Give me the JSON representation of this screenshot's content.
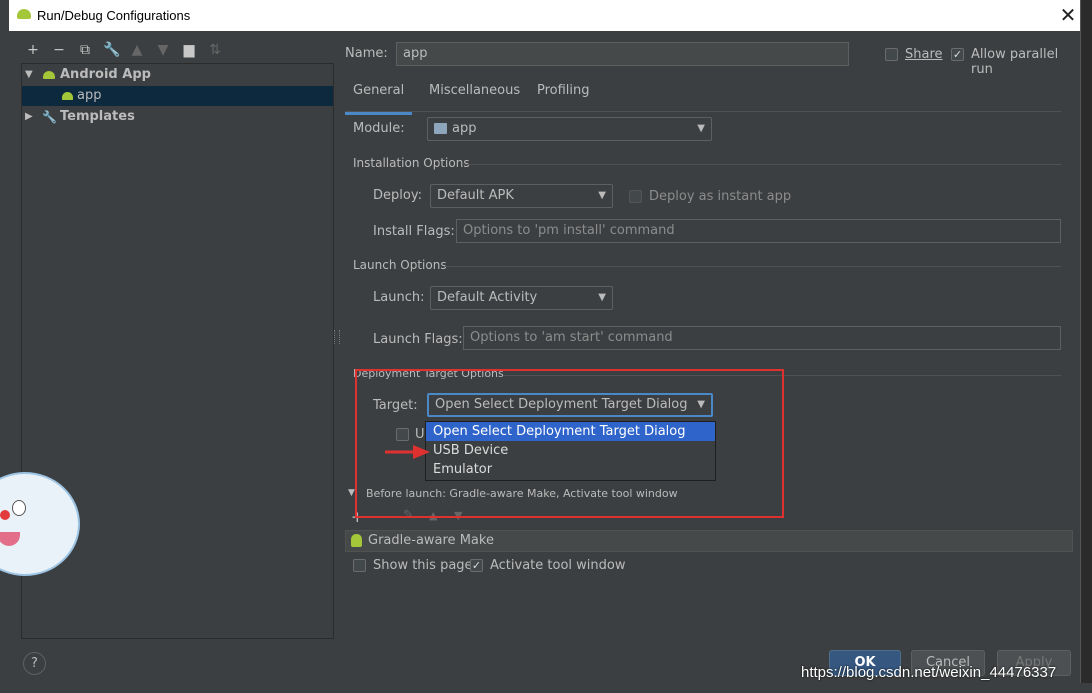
{
  "window": {
    "title": "Run/Debug Configurations",
    "close_glyph": "✕"
  },
  "toolbar": {
    "icons": [
      "add-icon",
      "remove-icon",
      "copy-icon",
      "wrench-icon",
      "move-up-icon",
      "move-down-icon",
      "folder-icon",
      "sort-icon"
    ]
  },
  "tree": {
    "android_app": "Android App",
    "app": "app",
    "templates": "Templates"
  },
  "header": {
    "name_label": "Name:",
    "name_value": "app",
    "share_label": "Share",
    "share_checked": false,
    "parallel_label": "Allow parallel run",
    "parallel_checked": true
  },
  "tabs": [
    {
      "label": "General",
      "active": true
    },
    {
      "label": "Miscellaneous",
      "active": false
    },
    {
      "label": "Profiling",
      "active": false
    }
  ],
  "module": {
    "label": "Module:",
    "value": "app"
  },
  "installation": {
    "section": "Installation Options",
    "deploy_label": "Deploy:",
    "deploy_value": "Default APK",
    "instant_label": "Deploy as instant app",
    "install_flags_label": "Install Flags:",
    "install_flags_placeholder": "Options to 'pm install' command"
  },
  "launch": {
    "section": "Launch Options",
    "launch_label": "Launch:",
    "launch_value": "Default Activity",
    "launch_flags_label": "Launch Flags:",
    "launch_flags_placeholder": "Options to 'am start' command"
  },
  "deployment": {
    "section": "Deployment Target Options",
    "target_label": "Target:",
    "target_value": "Open Select Deployment Target Dialog",
    "partial_checkbox_label": "U",
    "options": [
      "Open Select Deployment Target Dialog",
      "USB Device",
      "Emulator"
    ],
    "selected_index": 0
  },
  "before_launch": {
    "label": "Before launch: Gradle-aware Make, Activate tool window",
    "task": "Gradle-aware Make",
    "show_page_label": "Show this page",
    "show_page_checked": false,
    "activate_label": "Activate tool window",
    "activate_checked": true
  },
  "buttons": {
    "help": "?",
    "ok": "OK",
    "cancel": "Cancel",
    "apply": "Apply"
  },
  "watermark": "https://blog.csdn.net/weixin_44476337",
  "colors": {
    "accent": "#4a88c7",
    "selection": "#2f65ca",
    "highlight": "#e03131",
    "android": "#a4c639"
  }
}
